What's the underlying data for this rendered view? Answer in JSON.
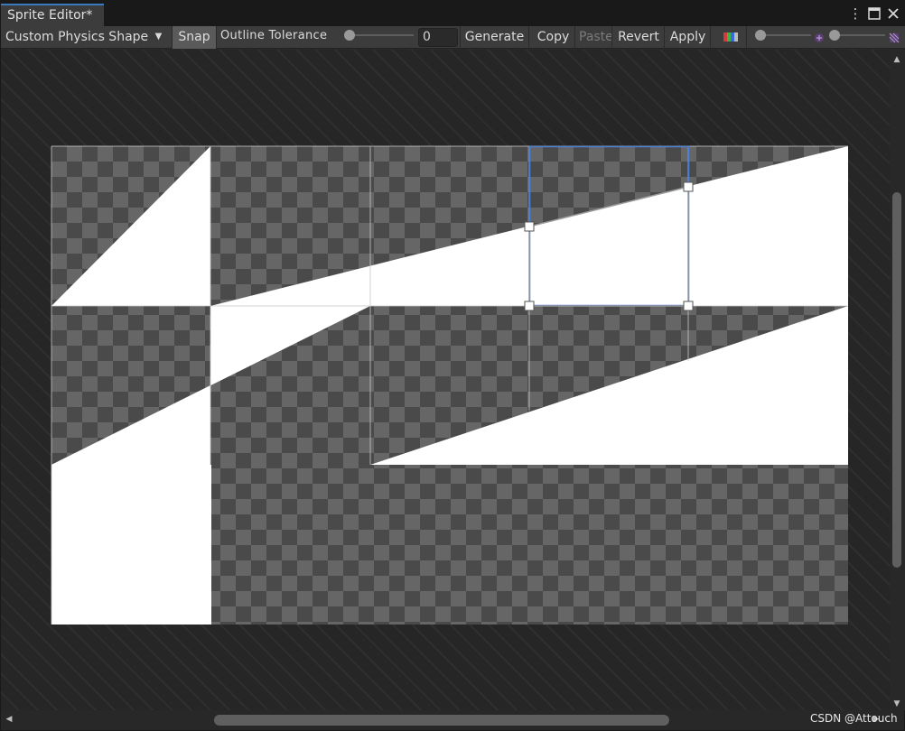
{
  "window": {
    "tab_title": "Sprite Editor*"
  },
  "window_controls": {
    "menu": "⋮",
    "maximize": "🗖",
    "close": "✕"
  },
  "toolbar": {
    "mode_dropdown": "Custom Physics Shape",
    "snap": "Snap",
    "outline_tolerance_label": "Outline Tolerance",
    "outline_tolerance_value": "0",
    "outline_tolerance_level": 0,
    "generate": "Generate",
    "copy": "Copy",
    "paste": "Paste",
    "revert": "Revert",
    "apply": "Apply"
  },
  "colors": {
    "checker_dark": "#4a4a4a",
    "checker_light": "#666666",
    "sprite_fill": "#ffffff",
    "selection": "#4a7fd4",
    "accent_tab": "#3a79bb"
  },
  "watermark": "CSDN @Attouch"
}
